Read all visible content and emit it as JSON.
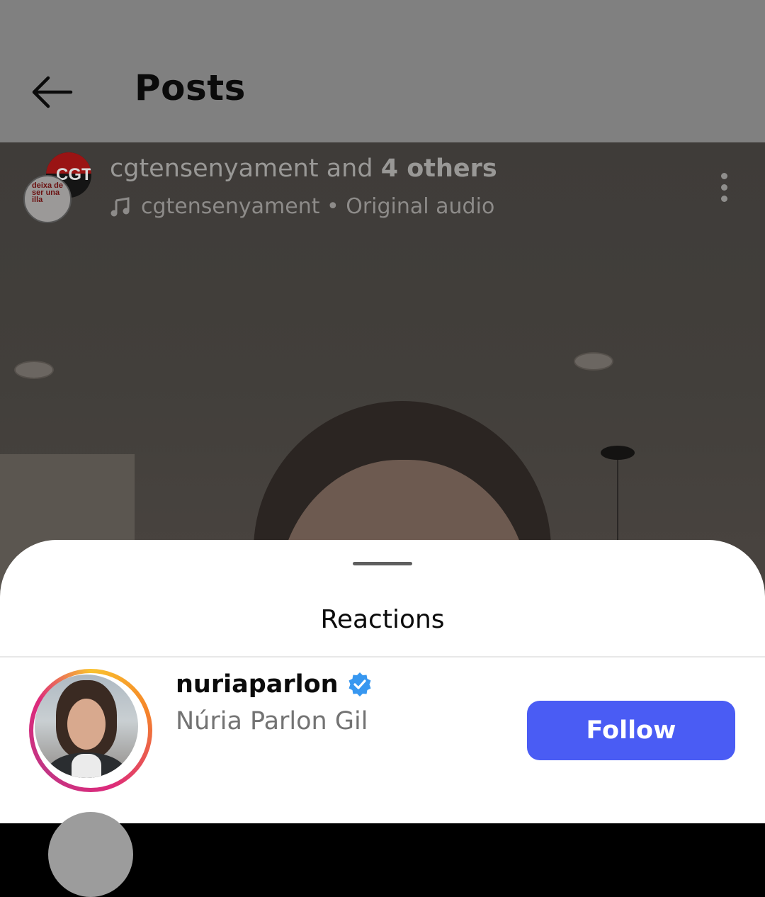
{
  "header": {
    "title": "Posts",
    "back_icon": "arrow-left-icon"
  },
  "post": {
    "user": "cgtensenyament",
    "and_text": "and",
    "others": "4 others",
    "audio_icon": "music-note-icon",
    "audio_text": "cgtensenyament • Original audio",
    "more_icon": "more-vertical-icon",
    "avatar_cgt_text": "CGT",
    "avatar_deixa_text": "deixa de ser una illa"
  },
  "sheet": {
    "title": "Reactions",
    "items": [
      {
        "username": "nuriaparlon",
        "verified": true,
        "full_name": "Núria Parlon Gil",
        "follow_label": "Follow"
      }
    ]
  },
  "colors": {
    "follow_button": "#4a5cf4",
    "verified_badge": "#3797f0"
  }
}
